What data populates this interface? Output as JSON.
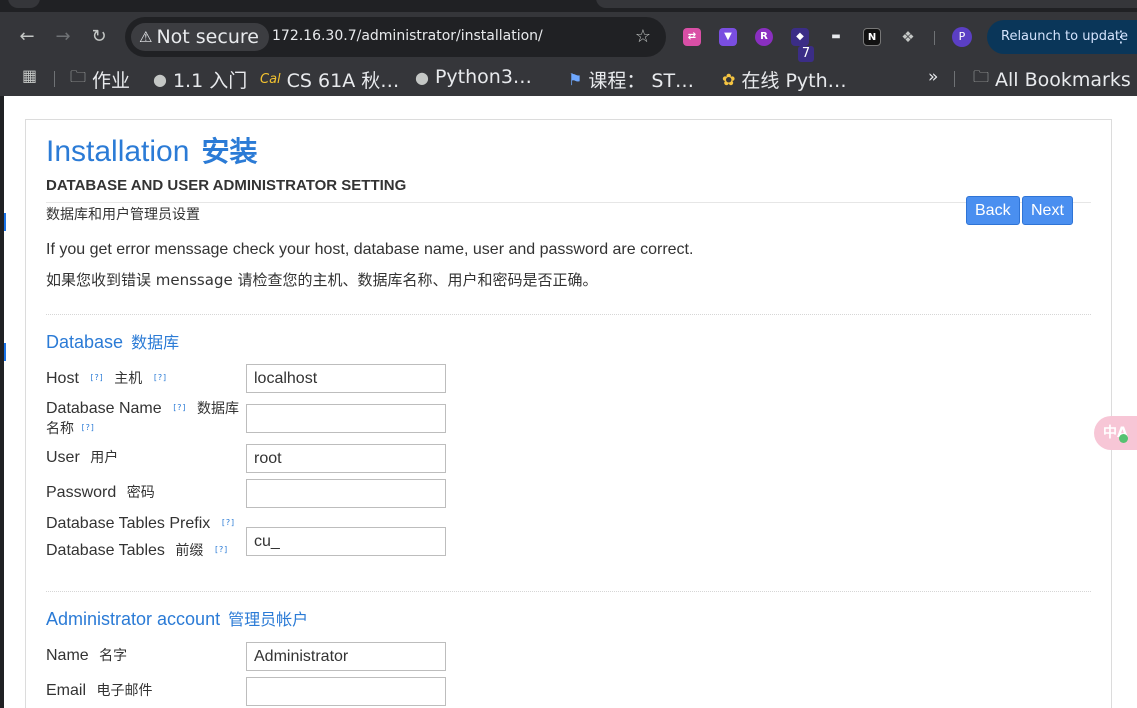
{
  "browser": {
    "security_label": "Not secure",
    "url": "172.16.30.7/administrator/installation/",
    "extension_badge": "7",
    "profile_initial": "P",
    "relaunch_label": "Relaunch to update",
    "more_bookmarks": "»",
    "bookmarks": [
      {
        "label": "作业",
        "icon": "folder-icon"
      },
      {
        "label": "1.1 入门",
        "icon": "globe-icon"
      },
      {
        "label": "CS 61A 秋…",
        "icon": "berkeley-icon"
      },
      {
        "label": "Python3…",
        "icon": "globe-icon"
      },
      {
        "label": "课程： ST…",
        "icon": "course-icon"
      },
      {
        "label": "在线 Pyth…",
        "icon": "python-icon"
      }
    ],
    "all_bookmarks": "All Bookmarks"
  },
  "page": {
    "title": "Installation",
    "title_cn": "安装",
    "subheading": "DATABASE AND USER ADMINISTRATOR SETTING",
    "subheading_cn": "数据库和用户管理员设置",
    "back_label": "Back",
    "next_label": "Next",
    "note_en": "If you get error menssage check your host, database name, user and password are correct.",
    "note_cn": "如果您收到错误 menssage 请检查您的主机、数据库名称、用户和密码是否正确。",
    "help_marker": "[?]"
  },
  "database": {
    "heading": "Database",
    "heading_cn": "数据库",
    "host_label": "Host",
    "host_label_cn": "主机",
    "host_value": "localhost",
    "dbname_label": "Database Name",
    "dbname_label_cn": "数据库",
    "dbname_label_cn2": "名称",
    "dbname_value": "",
    "user_label": "User",
    "user_label_cn": "用户",
    "user_value": "root",
    "password_label": "Password",
    "password_label_cn": "密码",
    "password_value": "",
    "prefix_label": "Database Tables Prefix",
    "prefix_label2": "Database Tables",
    "prefix_label_cn": "前缀",
    "prefix_value": "cu_"
  },
  "admin": {
    "heading": "Administrator account",
    "heading_cn": "管理员帐户",
    "name_label": "Name",
    "name_label_cn": "名字",
    "name_value": "Administrator",
    "email_label": "Email",
    "email_label_cn": "电子邮件",
    "email_value": ""
  },
  "translate_fab": "中A"
}
